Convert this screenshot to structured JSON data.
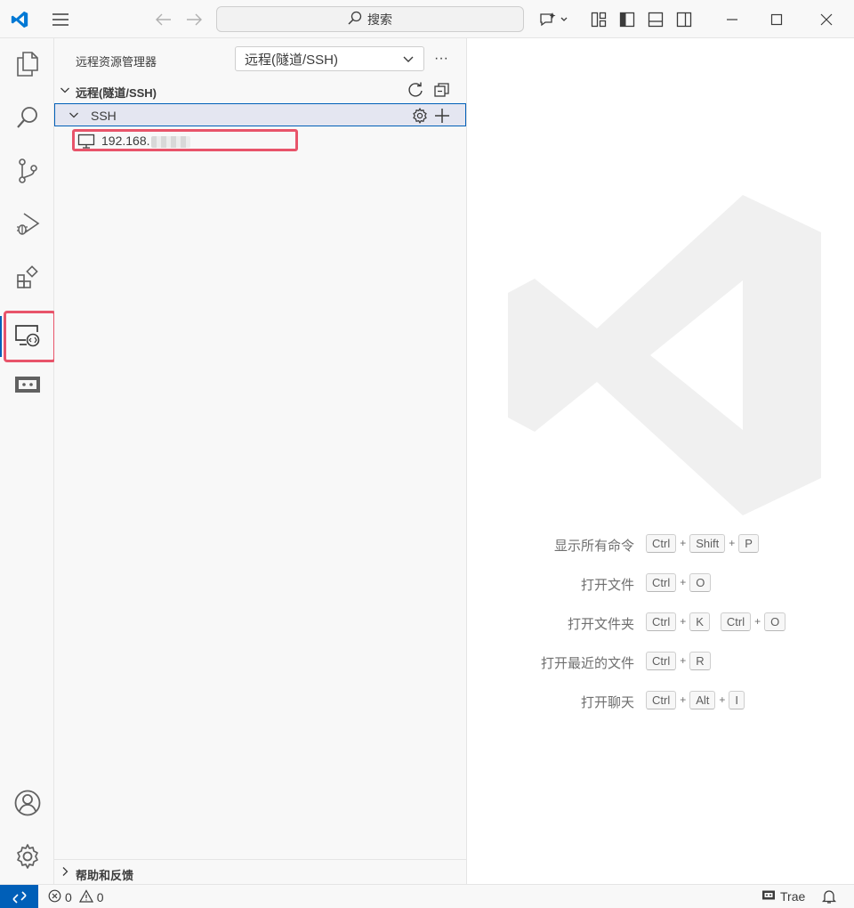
{
  "titlebar": {
    "search_label": "搜索"
  },
  "activity": {
    "items": [
      "explorer-icon",
      "search-icon",
      "source-control-icon",
      "run-debug-icon",
      "extensions-icon",
      "remote-explorer-icon",
      "remote-tunnel-icon"
    ],
    "active": "remote-explorer-icon",
    "bottom": [
      "accounts-icon",
      "manage-gear-icon"
    ]
  },
  "sidebar": {
    "title": "远程资源管理器",
    "select_value": "远程(隧道/SSH)",
    "more_label": "···",
    "section_title": "远程(隧道/SSH)",
    "group_label": "SSH",
    "host_label": "192.168.",
    "help_title": "帮助和反馈"
  },
  "editor": {
    "shortcuts": [
      {
        "label": "显示所有命令",
        "keys": [
          [
            "Ctrl",
            "Shift",
            "P"
          ]
        ]
      },
      {
        "label": "打开文件",
        "keys": [
          [
            "Ctrl",
            "O"
          ]
        ]
      },
      {
        "label": "打开文件夹",
        "keys": [
          [
            "Ctrl",
            "K"
          ],
          [
            "Ctrl",
            "O"
          ]
        ]
      },
      {
        "label": "打开最近的文件",
        "keys": [
          [
            "Ctrl",
            "R"
          ]
        ]
      },
      {
        "label": "打开聊天",
        "keys": [
          [
            "Ctrl",
            "Alt",
            "I"
          ]
        ]
      }
    ]
  },
  "statusbar": {
    "errors": "0",
    "warnings": "0",
    "trae_label": "Trae"
  },
  "colors": {
    "accent": "#005fb8",
    "highlight": "#e8546a",
    "watermark": "#f0f0f0"
  }
}
